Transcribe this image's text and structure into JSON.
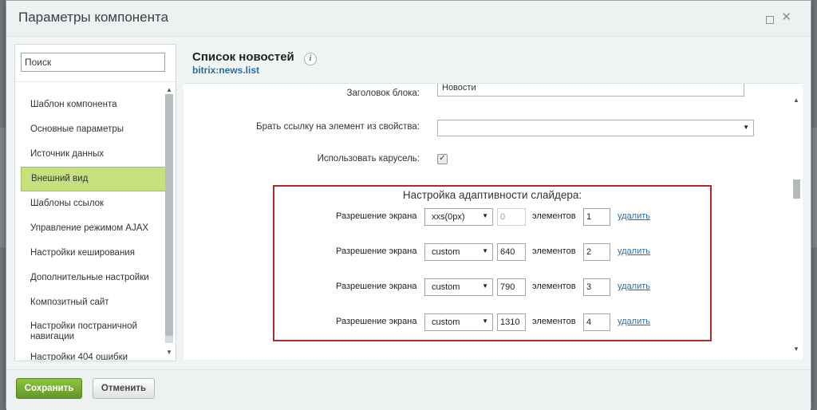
{
  "dialog": {
    "title": "Параметры компонента"
  },
  "sidebar": {
    "search_placeholder": "Поиск",
    "items": [
      {
        "label": "Шаблон компонента"
      },
      {
        "label": "Основные параметры"
      },
      {
        "label": "Источник данных"
      },
      {
        "label": "Внешний вид",
        "active": true
      },
      {
        "label": "Шаблоны ссылок"
      },
      {
        "label": "Управление режимом AJAX"
      },
      {
        "label": "Настройки кеширования"
      },
      {
        "label": "Дополнительные настройки"
      },
      {
        "label": "Композитный сайт"
      },
      {
        "label": "Настройки постраничной навигации"
      },
      {
        "label": "Настройки 404 ошибки"
      }
    ]
  },
  "component": {
    "title": "Список новостей",
    "code": "bitrix:news.list"
  },
  "form": {
    "block_title_label": "Заголовок блока:",
    "block_title_value": "Новости",
    "link_prop_label": "Брать ссылку на элемент из свойства:",
    "link_prop_value": "",
    "carousel_label": "Использовать карусель:",
    "carousel_checked": true
  },
  "adaptive": {
    "title": "Настройка адаптивности слайдера:",
    "rows": [
      {
        "label": "Разрешение экрана",
        "mode": "xxs(0px)",
        "px": "0",
        "px_disabled": true,
        "elements_label": "элементов",
        "count": "1",
        "delete": "удалить"
      },
      {
        "label": "Разрешение экрана",
        "mode": "custom",
        "px": "640",
        "px_disabled": false,
        "elements_label": "элементов",
        "count": "2",
        "delete": "удалить"
      },
      {
        "label": "Разрешение экрана",
        "mode": "custom",
        "px": "790",
        "px_disabled": false,
        "elements_label": "элементов",
        "count": "3",
        "delete": "удалить"
      },
      {
        "label": "Разрешение экрана",
        "mode": "custom",
        "px": "1310",
        "px_disabled": false,
        "elements_label": "элементов",
        "count": "4",
        "delete": "удалить"
      }
    ],
    "border_color": "#b02b25"
  },
  "footer": {
    "save_label": "Сохранить",
    "cancel_label": "Отменить"
  },
  "colors": {
    "active_item": "#c6e07e",
    "save_button": "#78ad32",
    "link": "#2d6c9c"
  }
}
